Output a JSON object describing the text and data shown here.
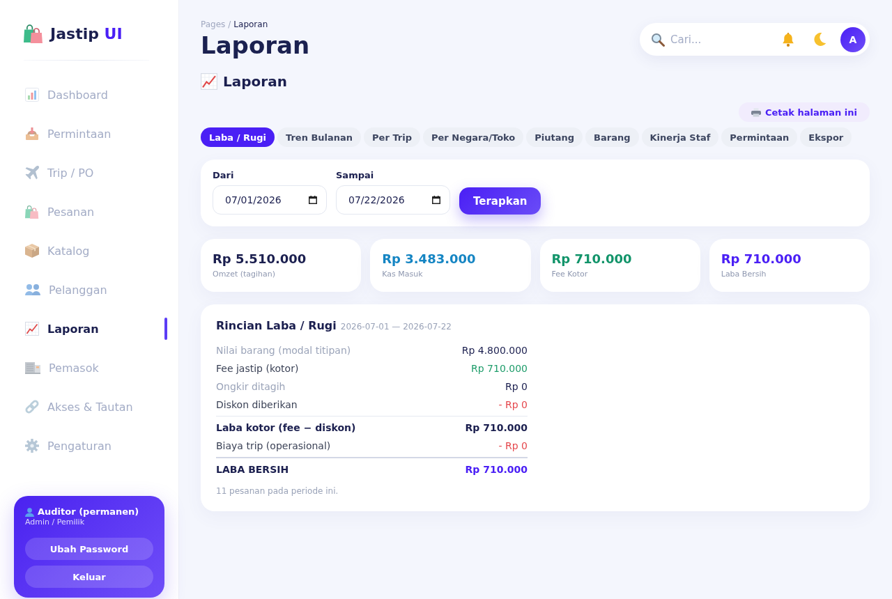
{
  "sidebar": {
    "logo": {
      "name": "Jastip",
      "accent": "UI"
    },
    "items": [
      {
        "label": "Dashboard",
        "selected": false
      },
      {
        "label": "Permintaan",
        "selected": false
      },
      {
        "label": "Trip / PO",
        "selected": false
      },
      {
        "label": "Pesanan",
        "selected": false
      },
      {
        "label": "Katalog",
        "selected": false
      },
      {
        "label": "Pelanggan",
        "selected": false
      },
      {
        "label": "Laporan",
        "selected": true
      },
      {
        "label": "Pemasok",
        "selected": false
      },
      {
        "label": "Akses & Tautan",
        "selected": false
      },
      {
        "label": "Pengaturan",
        "selected": false
      }
    ],
    "user_card": {
      "name": "Auditor (permanen)",
      "role": "Admin / Pemilik",
      "buttons": [
        "Ubah Password",
        "Keluar"
      ]
    }
  },
  "header": {
    "breadcrumb": {
      "items": [
        "Pages",
        "Laporan"
      ],
      "separator": "/"
    },
    "title": "Laporan",
    "search": {
      "placeholder": "Cari..."
    },
    "avatar": "A"
  },
  "section_title": "Laporan",
  "print_button": "Cetak halaman ini",
  "tabs": [
    {
      "label": "Laba / Rugi",
      "selected": true
    },
    {
      "label": "Tren Bulanan",
      "selected": false
    },
    {
      "label": "Per Trip",
      "selected": false
    },
    {
      "label": "Per Negara/Toko",
      "selected": false
    },
    {
      "label": "Piutang",
      "selected": false
    },
    {
      "label": "Barang",
      "selected": false
    },
    {
      "label": "Kinerja Staf",
      "selected": false
    },
    {
      "label": "Permintaan",
      "selected": false
    },
    {
      "label": "Ekspor",
      "selected": false
    }
  ],
  "filter": {
    "fields": [
      {
        "label": "Dari",
        "value": "07/01/2026"
      },
      {
        "label": "Sampai",
        "value": "07/22/2026"
      }
    ],
    "apply_button": "Terapkan"
  },
  "stats": [
    {
      "value": "Rp 5.510.000",
      "label": "Omzet (tagihan)",
      "color": "#1b1f4f"
    },
    {
      "value": "Rp 3.483.000",
      "label": "Kas Masuk",
      "color": "#1585c3"
    },
    {
      "value": "Rp 710.000",
      "label": "Fee Kotor",
      "color": "#12946a"
    },
    {
      "value": "Rp 710.000",
      "label": "Laba Bersih",
      "color": "#4a1ff5"
    }
  ],
  "breakdown": {
    "title": "Rincian Laba / Rugi",
    "period": "2026-07-01 — 2026-07-22",
    "rows": [
      {
        "label": "Nilai barang (modal titipan)",
        "value": "Rp 4.800.000",
        "kind": "item",
        "muted": true,
        "color": "#1b1f4f"
      },
      {
        "label": "Fee jastip (kotor)",
        "value": "Rp 710.000",
        "kind": "item",
        "muted": false,
        "color": "#1f9d6b"
      },
      {
        "label": "Ongkir ditagih",
        "value": "Rp 0",
        "kind": "item",
        "muted": true,
        "color": "#1b1f4f"
      },
      {
        "label": "Diskon diberikan",
        "value": "- Rp 0",
        "kind": "item",
        "muted": false,
        "color": "#e5484d"
      },
      {
        "label": "Laba kotor (fee − diskon)",
        "value": "Rp 710.000",
        "kind": "subtotal",
        "muted": false,
        "color": "#1b1f4f"
      },
      {
        "label": "Biaya trip (operasional)",
        "value": "- Rp 0",
        "kind": "item",
        "muted": false,
        "color": "#e5484d"
      },
      {
        "label": "LABA BERSIH",
        "value": "Rp 710.000",
        "kind": "total",
        "muted": false,
        "color": "#4a1ff5"
      }
    ],
    "footnote": "11 pesanan pada periode ini."
  }
}
